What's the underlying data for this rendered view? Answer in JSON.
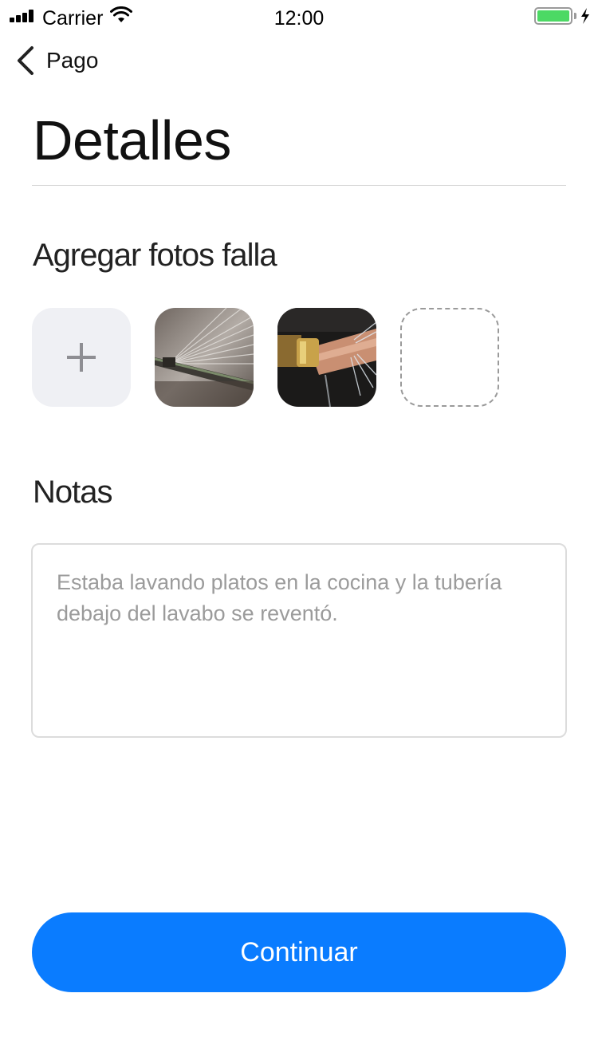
{
  "status_bar": {
    "carrier": "Carrier",
    "time": "12:00",
    "battery_level": 1.0,
    "battery_color": "#4cd964"
  },
  "nav": {
    "back_label": "Pago",
    "back_icon": "chevron-left-icon"
  },
  "page": {
    "title": "Detalles"
  },
  "photos": {
    "title": "Agregar fotos falla",
    "add_icon": "plus-icon",
    "items": [
      "water-spray-photo",
      "burst-pipe-photo"
    ],
    "empty_slots": 1
  },
  "notes": {
    "title": "Notas",
    "placeholder": "Estaba lavando platos en la cocina y la tubería debajo del lavabo se reventó."
  },
  "actions": {
    "continue_label": "Continuar",
    "accent": "#0a7cff"
  }
}
